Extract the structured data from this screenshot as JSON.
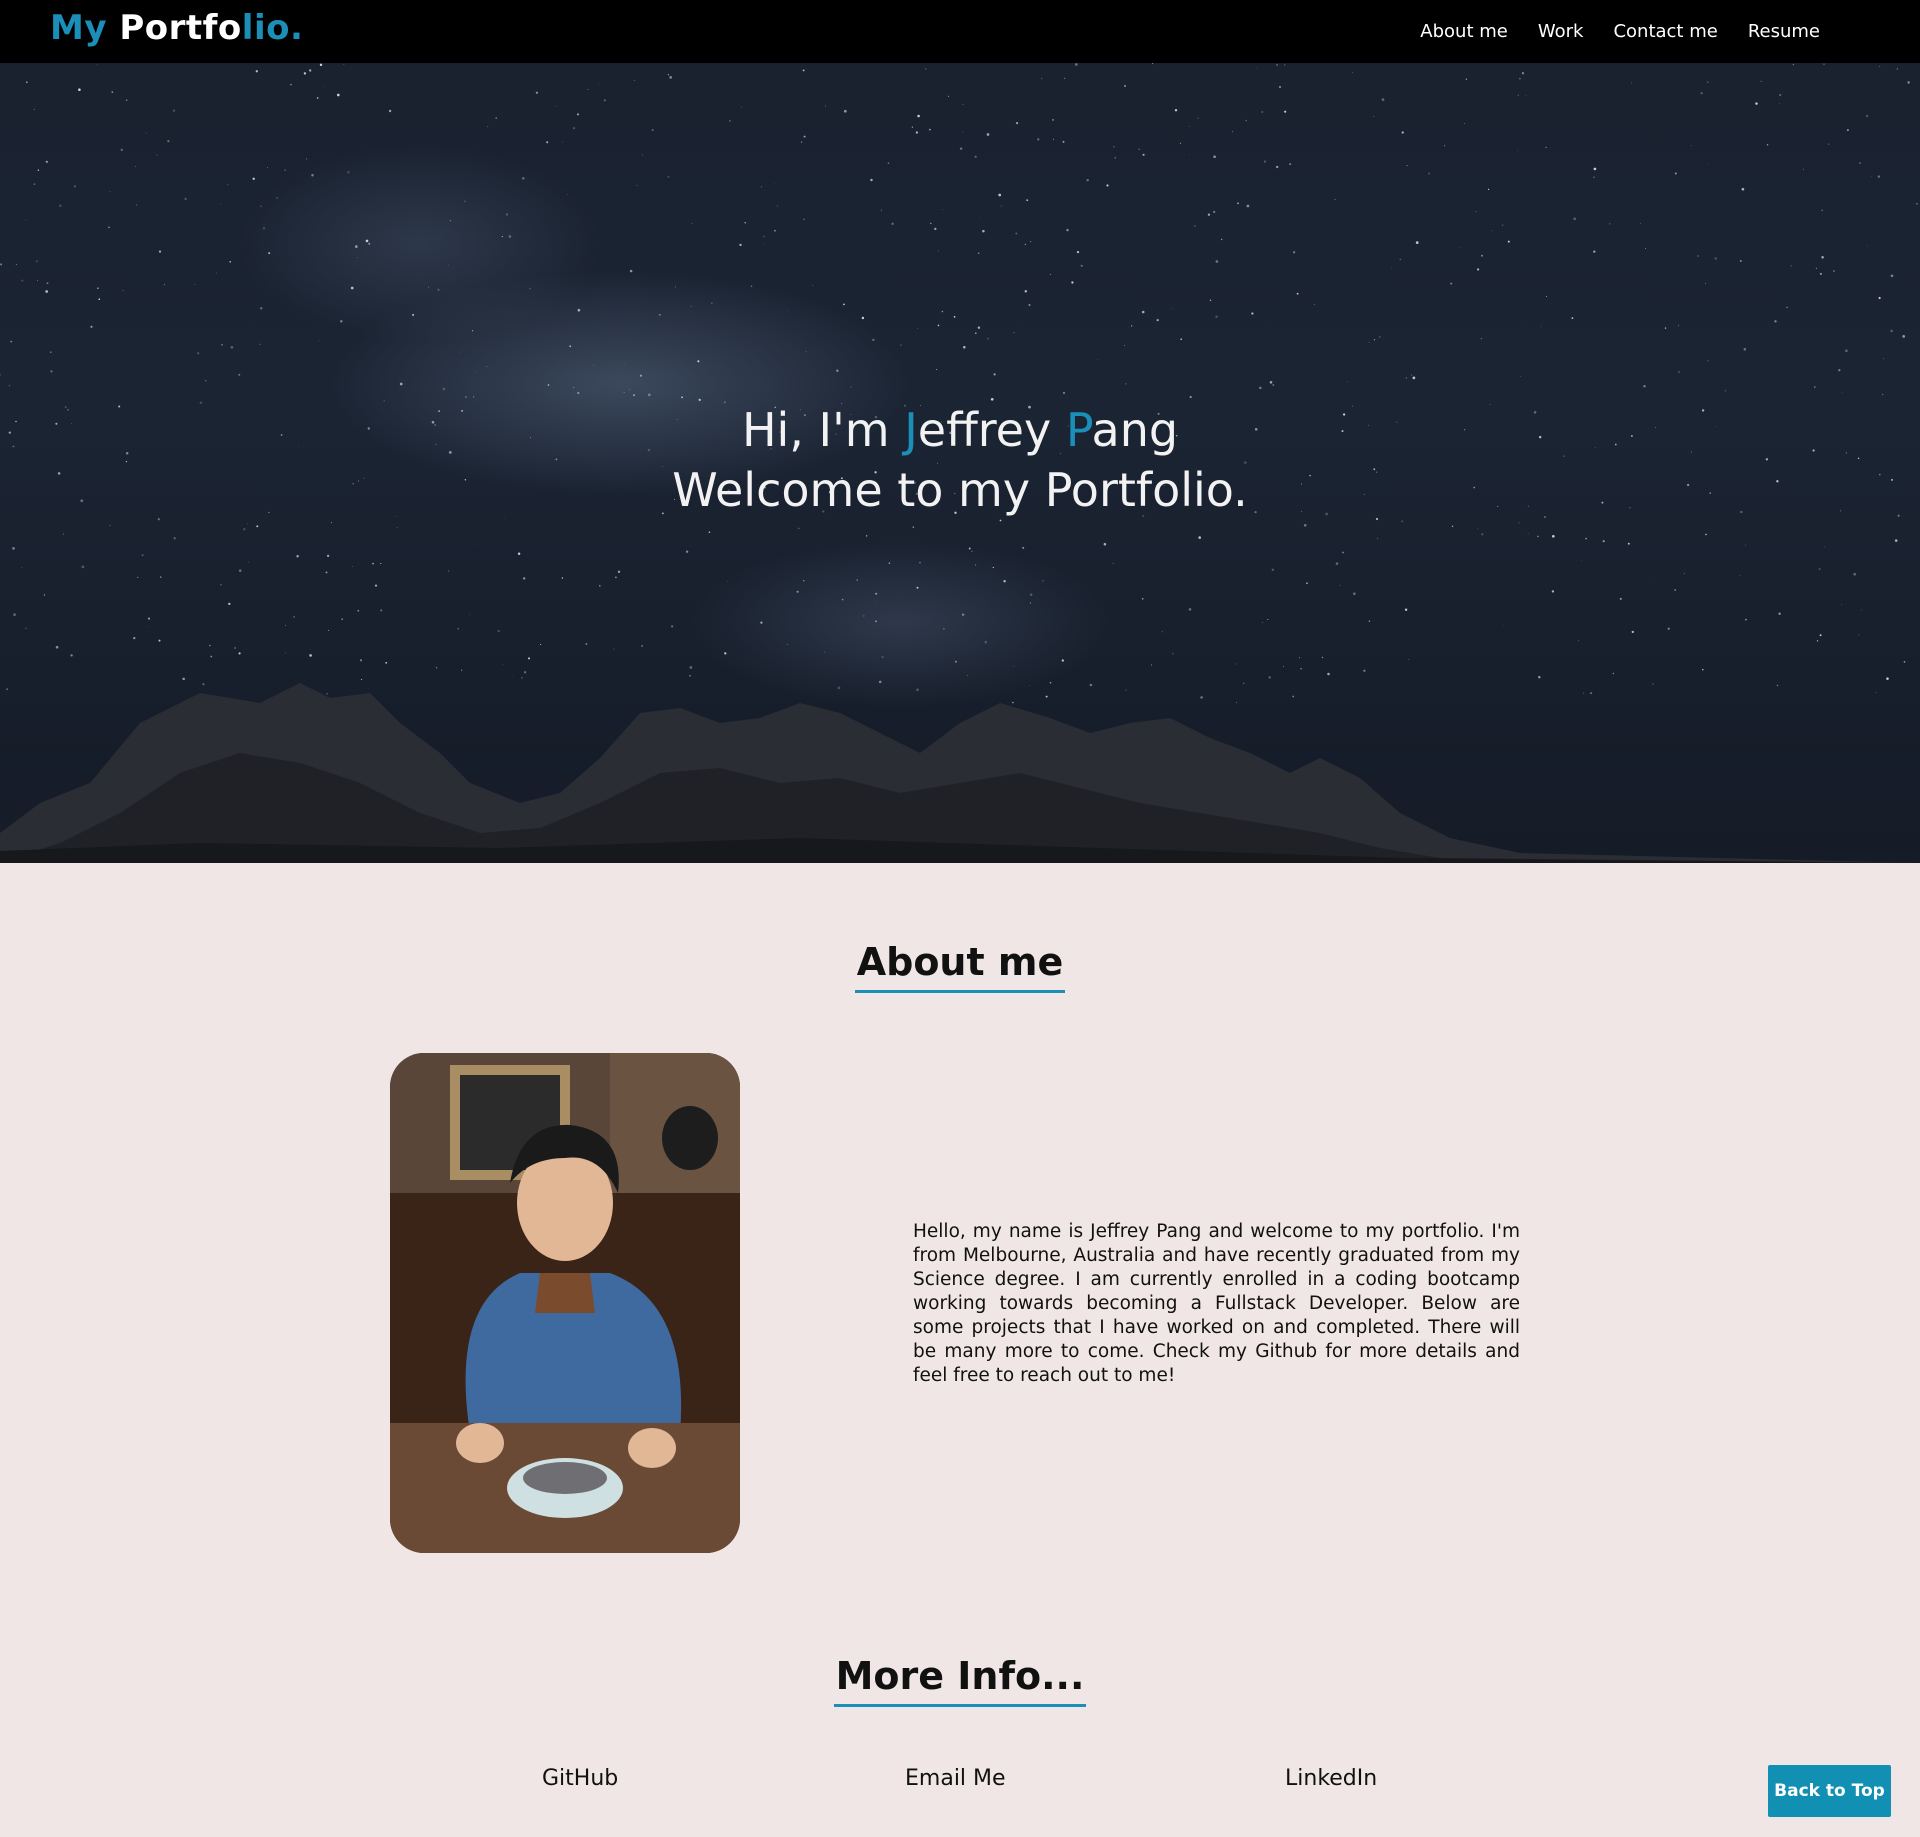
{
  "brand": {
    "part1": "My ",
    "part2": "Portfo",
    "part3": "lio."
  },
  "nav": [
    {
      "label": "About me"
    },
    {
      "label": "Work"
    },
    {
      "label": "Contact me"
    },
    {
      "label": "Resume"
    }
  ],
  "hero": {
    "greeting_pre": "Hi, I'm ",
    "first_initial": "J",
    "first_rest": "effrey ",
    "last_initial": "P",
    "last_rest": "ang",
    "line2": "Welcome to my Portfolio."
  },
  "about": {
    "title": "About me",
    "bio": "Hello, my name is Jeffrey Pang and welcome to my portfolio. I'm from Melbourne, Australia and have recently graduated from my Science degree. I am currently enrolled in a coding bootcamp working towards becoming a Fullstack Developer. Below are some projects that I have worked on and completed. There will be many more to come. Check my Github for more details and feel free to reach out to me!"
  },
  "more_info": {
    "title": "More Info...",
    "links": [
      {
        "label": "GitHub"
      },
      {
        "label": "Email Me"
      },
      {
        "label": "LinkedIn"
      }
    ]
  },
  "back_to_top": "Back to Top",
  "colors": {
    "accent": "#1b8fb8",
    "nav_bg": "#000000",
    "page_bg": "#f0e6e5",
    "button_bg": "#1190b3"
  }
}
